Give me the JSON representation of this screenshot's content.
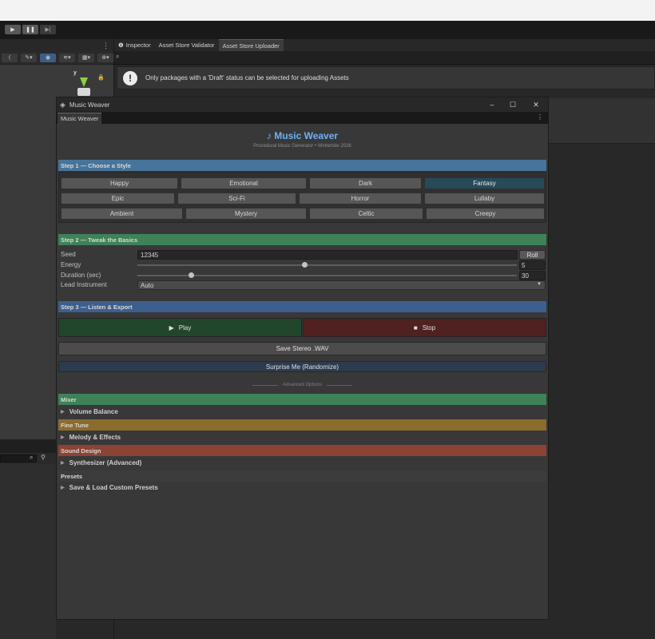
{
  "editor": {
    "tabs": [
      {
        "label": "Inspector",
        "icon": "info-icon"
      },
      {
        "label": "Asset Store Validator"
      },
      {
        "label": "Asset Store Uploader",
        "active": true
      }
    ],
    "notice": "Only packages with a 'Draft' status can be selected for uploading Assets",
    "gizmo_axis": "y"
  },
  "window": {
    "title": "Music Weaver",
    "tab": "Music Weaver",
    "app_title": "♪ Music Weaver",
    "app_subtitle": "Procedural Music Generator • Wintertide 2026",
    "step1": {
      "header": "Step 1 — Choose a Style",
      "styles_row1": [
        "Happy",
        "Emotional",
        "Dark",
        "Fantasy"
      ],
      "styles_row2": [
        "Epic",
        "Sci-Fi",
        "Horror",
        "Lullaby"
      ],
      "styles_row3": [
        "Ambient",
        "Mystery",
        "Celtic",
        "Creepy"
      ],
      "selected": "Fantasy"
    },
    "step2": {
      "header": "Step 2 — Tweak the Basics",
      "seed_label": "Seed",
      "seed_value": "12345",
      "roll_label": "Roll",
      "energy_label": "Energy",
      "energy_value": "5",
      "energy_fraction": 0.44,
      "duration_label": "Duration (sec)",
      "duration_value": "30",
      "duration_fraction": 0.14,
      "instrument_label": "Lead Instrument",
      "instrument_value": "Auto"
    },
    "step3": {
      "header": "Step 3 — Listen & Export",
      "play_label": "Play",
      "stop_label": "Stop",
      "save_label": "Save Stereo .WAV",
      "surprise_label": "Surprise Me (Randomize)"
    },
    "advanced_label": "Advanced Options",
    "sections": {
      "mixer": {
        "header": "Mixer",
        "item": "Volume Balance"
      },
      "finetune": {
        "header": "Fine Tune",
        "item": "Melody & Effects"
      },
      "sound": {
        "header": "Sound Design",
        "item": "Synthesizer (Advanced)"
      },
      "presets": {
        "header": "Presets",
        "item": "Save & Load Custom Presets"
      }
    }
  },
  "colors": {
    "step1_header": "#46749a",
    "step2_header": "#3e8257",
    "step3_header": "#3d5f8d",
    "mixer_header": "#3e8257",
    "finetune_header": "#8c6c2d",
    "sound_header": "#8b4334",
    "presets_header": "#3c3c3c",
    "play_button": "#22462b",
    "stop_button": "#4f2121",
    "accent_title": "#6eb1f4"
  }
}
